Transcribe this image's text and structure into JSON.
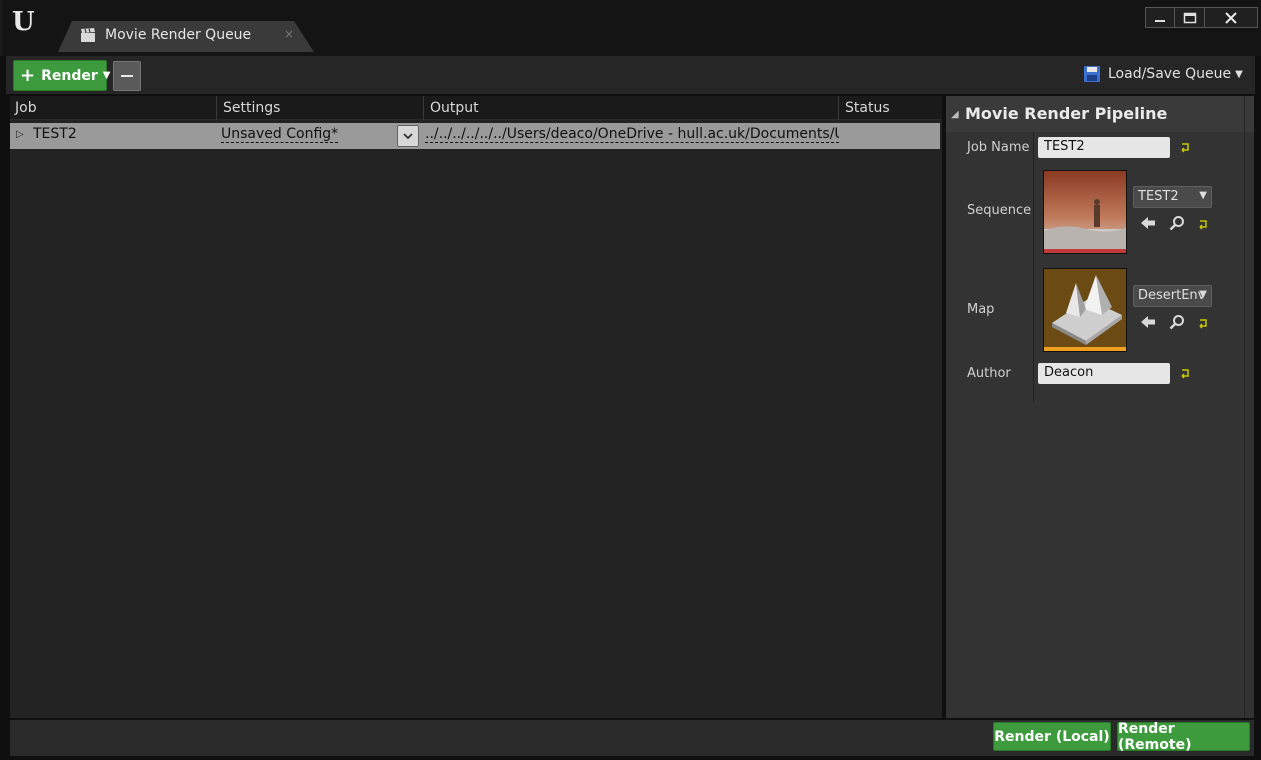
{
  "window": {
    "tab_title": "Movie Render Queue",
    "tab_close": "×"
  },
  "toolbar": {
    "render_label": "Render",
    "render_plus": "+",
    "load_save_label": "Load/Save Queue"
  },
  "job_list": {
    "columns": [
      "Job",
      "Settings",
      "Output",
      "Status"
    ],
    "rows": [
      {
        "job": "TEST2",
        "settings": "Unsaved Config",
        "settings_dirty_marker": "*",
        "output": "../../../../../../Users/deaco/OneDrive - hull.ac.uk/Documents/U",
        "status": ""
      }
    ]
  },
  "details": {
    "title": "Movie Render Pipeline",
    "job_name_label": "Job Name",
    "job_name_value": "TEST2",
    "sequence_label": "Sequence",
    "sequence_value": "TEST2",
    "map_label": "Map",
    "map_value": "DesertEnv",
    "author_label": "Author",
    "author_value": "Deacon"
  },
  "footer": {
    "render_local": "Render (Local)",
    "render_remote": "Render (Remote)"
  },
  "colors": {
    "accent_green": "#3d9a3d",
    "sequence_thumb_bar": "#c0393b",
    "map_thumb_bar": "#f0a020",
    "reset_arrow": "#c8c800"
  },
  "icons": [
    "unreal-logo-icon",
    "clapperboard-icon",
    "minimize-icon",
    "maximize-icon",
    "close-icon",
    "plus-icon",
    "remove-icon",
    "save-icon",
    "back-arrow-icon",
    "browse-magnifier-icon",
    "reset-to-default-icon"
  ]
}
